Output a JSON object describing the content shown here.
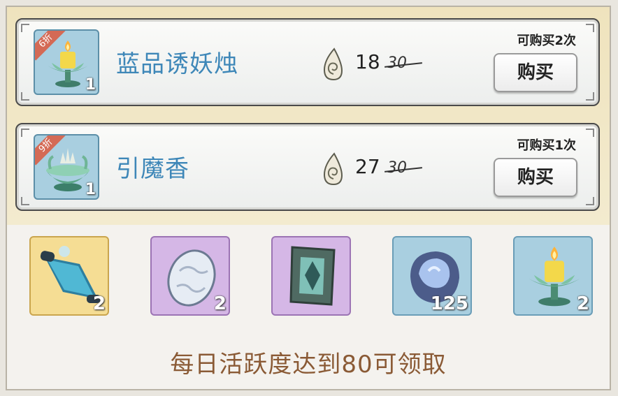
{
  "shop": {
    "items": [
      {
        "name": "蓝品诱妖烛",
        "discount": "6折",
        "count": "1",
        "price": "18",
        "original_price": "30",
        "purchase_limit": "可购买2次",
        "buy_label": "购买",
        "icon": "candle-icon"
      },
      {
        "name": "引魔香",
        "discount": "9折",
        "count": "1",
        "price": "27",
        "original_price": "30",
        "purchase_limit": "可购买1次",
        "buy_label": "购买",
        "icon": "incense-burner-icon"
      }
    ],
    "currency_icon": "spirit-jade-icon"
  },
  "rewards": {
    "items": [
      {
        "icon": "scroll-icon",
        "count": "2",
        "rarity": "gold"
      },
      {
        "icon": "egg-icon",
        "count": "2",
        "rarity": "purple"
      },
      {
        "icon": "talisman-icon",
        "count": "",
        "rarity": "purple"
      },
      {
        "icon": "crystal-icon",
        "count": "125",
        "rarity": "blue"
      },
      {
        "icon": "candle-icon",
        "count": "2",
        "rarity": "blue"
      }
    ],
    "footer": "每日活跃度达到80可领取"
  },
  "colors": {
    "name_blue": "#3e87b8",
    "footer_brown": "#8a5a35",
    "discount_red": "#d46a55"
  }
}
